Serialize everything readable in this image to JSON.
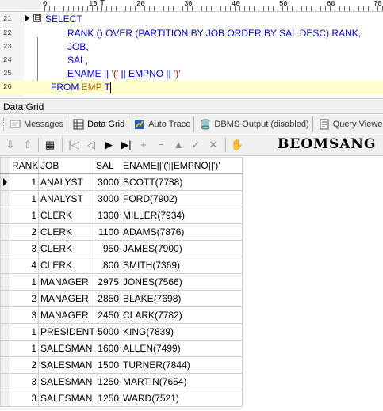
{
  "ruler": {
    "marks": [
      "0",
      "10",
      "20",
      "30",
      "40",
      "50",
      "60",
      "70"
    ],
    "cursor_mark": "T"
  },
  "editor": {
    "lines": [
      {
        "num": "21",
        "parts": [
          {
            "t": "SELECT",
            "c": "kw"
          }
        ]
      },
      {
        "num": "22",
        "parts": [
          {
            "t": "RANK () OVER (PARTITION BY JOB ORDER BY SAL DESC) RANK,",
            "c": "kw"
          }
        ]
      },
      {
        "num": "23",
        "parts": [
          {
            "t": "JOB,",
            "c": "kw"
          }
        ]
      },
      {
        "num": "24",
        "parts": [
          {
            "t": "SAL,",
            "c": "kw"
          }
        ]
      },
      {
        "num": "25",
        "parts": [
          {
            "t": "ENAME || ",
            "c": "kw"
          },
          {
            "t": "'('",
            "c": "red"
          },
          {
            "t": " || EMPNO || ",
            "c": "kw"
          },
          {
            "t": "')'",
            "c": "red"
          }
        ]
      },
      {
        "num": "26",
        "parts": [
          {
            "t": "FROM ",
            "c": "kw"
          },
          {
            "t": "EMP",
            "c": "orange"
          },
          {
            "t": " T",
            "c": "kw"
          }
        ]
      }
    ],
    "fold_glyph": "⊟"
  },
  "panel": {
    "title": "Data Grid"
  },
  "tabs": [
    {
      "label": "Messages",
      "icon": "messages-icon"
    },
    {
      "label": "Data Grid",
      "icon": "data-grid-icon"
    },
    {
      "label": "Auto Trace",
      "icon": "auto-trace-icon"
    },
    {
      "label": "DBMS Output (disabled)",
      "icon": "dbms-output-icon"
    },
    {
      "label": "Query Viewer",
      "icon": "query-viewer-icon"
    }
  ],
  "toolbar": {
    "brand": "BEOMSANG"
  },
  "grid": {
    "columns": [
      "RANK",
      "JOB",
      "SAL",
      "ENAME||'('||EMPNO||')'"
    ],
    "rows": [
      [
        "1",
        "ANALYST",
        "3000",
        "SCOTT(7788)"
      ],
      [
        "1",
        "ANALYST",
        "3000",
        "FORD(7902)"
      ],
      [
        "1",
        "CLERK",
        "1300",
        "MILLER(7934)"
      ],
      [
        "2",
        "CLERK",
        "1100",
        "ADAMS(7876)"
      ],
      [
        "3",
        "CLERK",
        "950",
        "JAMES(7900)"
      ],
      [
        "4",
        "CLERK",
        "800",
        "SMITH(7369)"
      ],
      [
        "1",
        "MANAGER",
        "2975",
        "JONES(7566)"
      ],
      [
        "2",
        "MANAGER",
        "2850",
        "BLAKE(7698)"
      ],
      [
        "3",
        "MANAGER",
        "2450",
        "CLARK(7782)"
      ],
      [
        "1",
        "PRESIDENT",
        "5000",
        "KING(7839)"
      ],
      [
        "1",
        "SALESMAN",
        "1600",
        "ALLEN(7499)"
      ],
      [
        "2",
        "SALESMAN",
        "1500",
        "TURNER(7844)"
      ],
      [
        "3",
        "SALESMAN",
        "1250",
        "MARTIN(7654)"
      ],
      [
        "3",
        "SALESMAN",
        "1250",
        "WARD(7521)"
      ]
    ]
  },
  "colors": {
    "keyword": "#0000ff",
    "string": "#cc0000",
    "table_name": "#cc6600",
    "current_line": "#ffffcc"
  }
}
